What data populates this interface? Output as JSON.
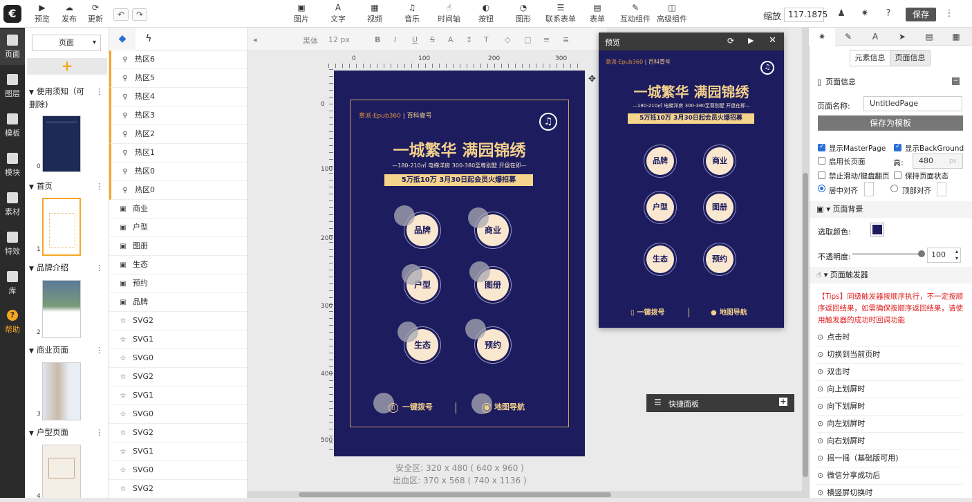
{
  "nav": {
    "items": [
      {
        "label": "页面",
        "icon": "page-icon",
        "active": true
      },
      {
        "label": "图层",
        "icon": "layers-icon"
      },
      {
        "label": "模板",
        "icon": "template-icon"
      },
      {
        "label": "模块",
        "icon": "module-icon"
      },
      {
        "label": "素材",
        "icon": "assets-icon"
      },
      {
        "label": "特效",
        "icon": "effects-icon"
      },
      {
        "label": "库",
        "icon": "library-icon"
      },
      {
        "label": "帮助",
        "icon": "help-icon"
      }
    ]
  },
  "toolbar": {
    "preview": "预览",
    "publish": "发布",
    "update": "更新",
    "image": "图片",
    "text": "文字",
    "video": "视频",
    "music": "音乐",
    "timeline": "时间轴",
    "button": "按钮",
    "shape": "图形",
    "contact_form": "联系表单",
    "form": "表单",
    "interactive": "互动组件",
    "advanced": "高级组件",
    "zoom_label": "缩放",
    "zoom_value": "117.1875",
    "save": "保存"
  },
  "pages": {
    "selector": "页面",
    "add": "+",
    "groups": [
      {
        "title": "使用须知（可删除)",
        "num": "0"
      },
      {
        "title": "首页",
        "num": "1"
      },
      {
        "title": "品牌介绍",
        "num": "2"
      },
      {
        "title": "商业页面",
        "num": "3"
      },
      {
        "title": "户型页面",
        "num": "4"
      }
    ]
  },
  "layers": [
    {
      "name": "热区6",
      "type": "link"
    },
    {
      "name": "热区5",
      "type": "link"
    },
    {
      "name": "热区4",
      "type": "link"
    },
    {
      "name": "热区3",
      "type": "link"
    },
    {
      "name": "热区2",
      "type": "link"
    },
    {
      "name": "热区1",
      "type": "link"
    },
    {
      "name": "热区0",
      "type": "link"
    },
    {
      "name": "热区0",
      "type": "link"
    },
    {
      "name": "商业",
      "type": "image"
    },
    {
      "name": "户型",
      "type": "image"
    },
    {
      "name": "图册",
      "type": "image"
    },
    {
      "name": "生态",
      "type": "image"
    },
    {
      "name": "预约",
      "type": "image"
    },
    {
      "name": "品牌",
      "type": "image"
    },
    {
      "name": "SVG2",
      "type": "svg"
    },
    {
      "name": "SVG1",
      "type": "svg"
    },
    {
      "name": "SVG0",
      "type": "svg"
    },
    {
      "name": "SVG2",
      "type": "svg"
    },
    {
      "name": "SVG1",
      "type": "svg"
    },
    {
      "name": "SVG0",
      "type": "svg"
    },
    {
      "name": "SVG2",
      "type": "svg"
    },
    {
      "name": "SVG1",
      "type": "svg"
    },
    {
      "name": "SVG0",
      "type": "svg"
    },
    {
      "name": "SVG2",
      "type": "svg"
    }
  ],
  "format": {
    "font": "黑体",
    "size": "12 px"
  },
  "ruler": {
    "top": [
      "0",
      "100",
      "200",
      "300"
    ],
    "left": [
      "0",
      "100",
      "200",
      "300",
      "400",
      "500"
    ]
  },
  "poster": {
    "brand": "意派·Epub360",
    "brand_sub": "百科壹号",
    "headline": "一城繁华 满园锦绣",
    "subline": "—180-210㎡ 电梯洋房  300-380至尊别墅  开盘在即—",
    "banner": "5万抵10万 3月30日起会员火爆招募",
    "buttons": [
      "品牌",
      "商业",
      "户型",
      "图册",
      "生态",
      "预约"
    ],
    "call": "一键拨号",
    "map": "地图导航"
  },
  "canvas_info": {
    "safe": "安全区: 320 x 480 ( 640 x 960 )",
    "bleed": "出血区: 370 x 568 ( 740 x 1136 )"
  },
  "preview": {
    "title": "预览"
  },
  "quick_panel": {
    "title": "快捷面板"
  },
  "right": {
    "tab_element": "元素信息",
    "tab_page": "页面信息",
    "section_page": "页面信息",
    "page_name_label": "页面名称:",
    "page_name": "UntitledPage",
    "save_template": "保存为模板",
    "show_master": "显示MasterPage",
    "show_bg": "显示BackGround",
    "long_page": "启用长页面",
    "height_label": "高:",
    "height_value": "480",
    "height_unit": "px",
    "disable_swipe": "禁止滑动/键盘翻页",
    "keep_state": "保持页面状态",
    "center_align": "居中对齐",
    "top_align": "顶部对齐",
    "section_bg": "页面背景",
    "pick_color": "选取颜色:",
    "bg_color": "#1c1c5e",
    "opacity_label": "不透明度:",
    "opacity_value": "100",
    "section_trigger": "页面触发器",
    "tips": "【Tips】同级触发器按顺序执行，不一定按顺序返回结果，如需确保按顺序返回结果，请使用触发器的成功时回调功能",
    "triggers": [
      "点击时",
      "切换到当前页时",
      "双击时",
      "向上划屏时",
      "向下划屏时",
      "向左划屏时",
      "向右划屏时",
      "摇一摇（基础版可用)",
      "微信分享成功后",
      "横竖屏切换时"
    ]
  }
}
